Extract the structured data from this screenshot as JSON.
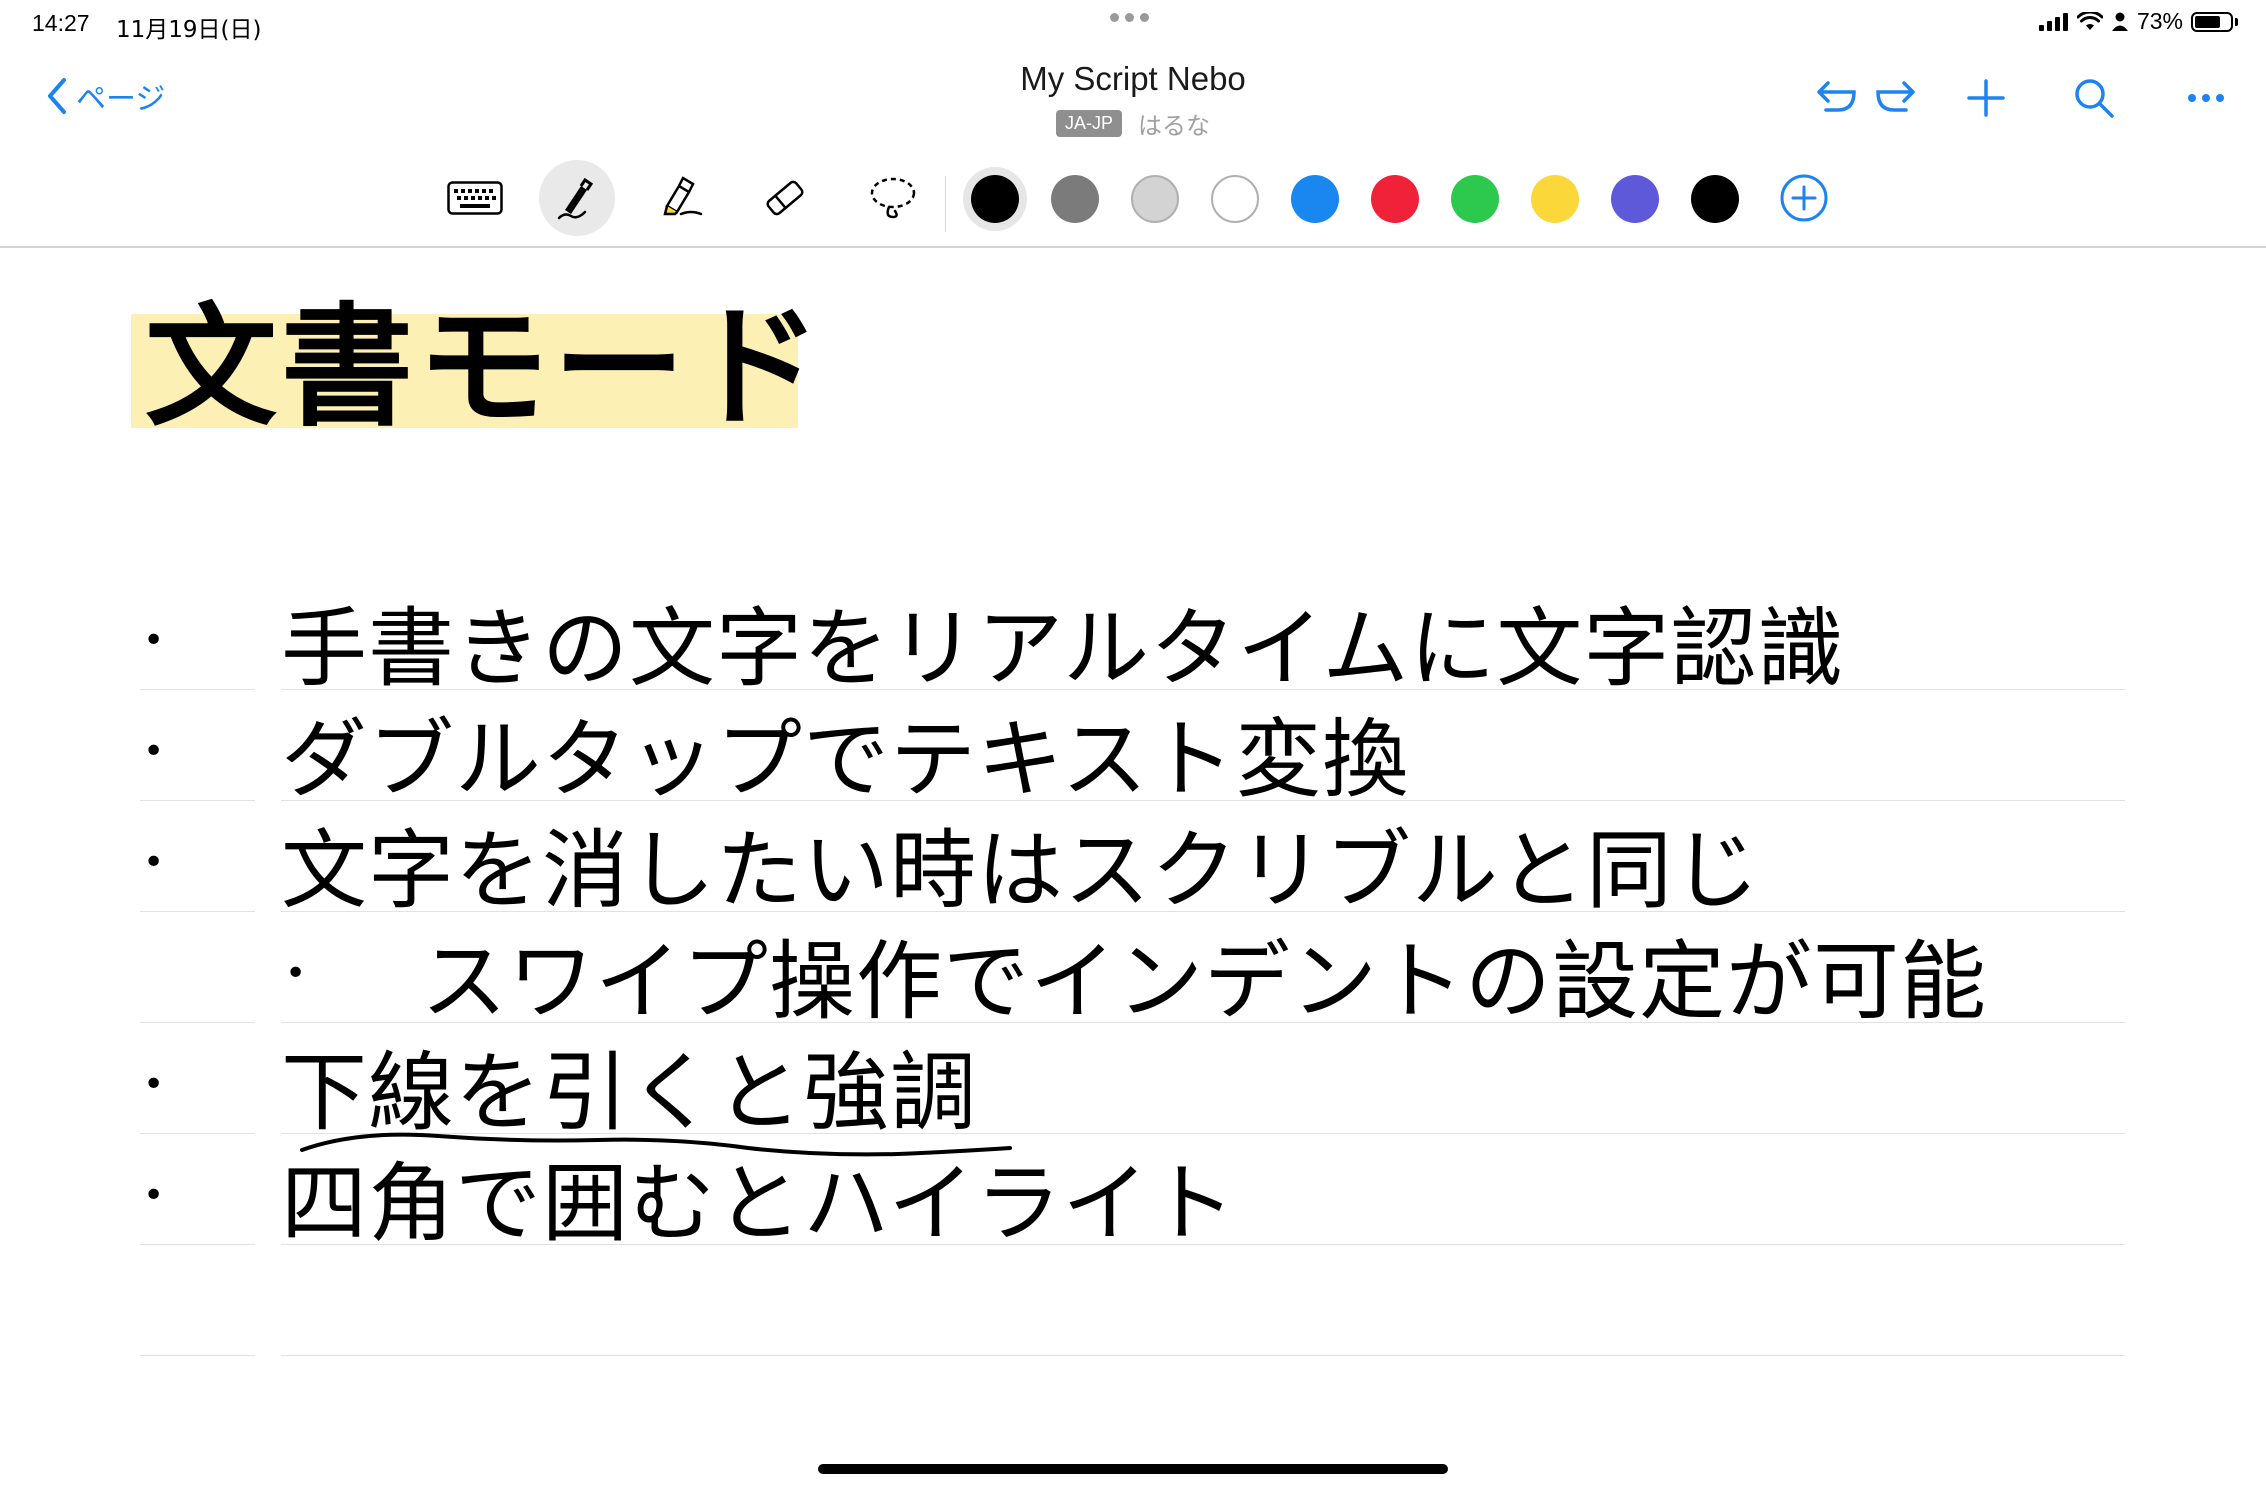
{
  "status_bar": {
    "time": "14:27",
    "date": "11月19日(日)",
    "battery": "73%",
    "battery_level": 0.73
  },
  "nav": {
    "back_label": "ページ",
    "title": "My Script Nebo",
    "language_badge": "JA-JP",
    "handwriting_name": "はるな",
    "accent_color": "#1e83f2"
  },
  "toolbar": {
    "tools": [
      "keyboard-icon",
      "pen-icon",
      "highlighter-icon",
      "eraser-icon",
      "lasso-icon"
    ],
    "selected_tool": "pen-icon",
    "colors": [
      "#000000",
      "#7b7b7b",
      "#d3d3d3",
      "#ffffff",
      "#1a86f0",
      "#f0223a",
      "#2dc94e",
      "#fbd73a",
      "#5e59d8",
      "#000000"
    ],
    "selected_color": "#000000"
  },
  "document": {
    "heading": "文書モード",
    "heading_highlight_color": "#fdf0b5",
    "items": [
      {
        "level": 1,
        "text": "手書きの文字をリアルタイムに文字認識"
      },
      {
        "level": 1,
        "text": "ダブルタップでテキスト変換"
      },
      {
        "level": 1,
        "text": "文字を消したい時はスクリブルと同じ"
      },
      {
        "level": 2,
        "text": "スワイプ操作でインデントの設定が可能"
      },
      {
        "level": 1,
        "text": "下線を引くと強調"
      },
      {
        "level": 1,
        "text": "四角で囲むとハイライト"
      }
    ]
  }
}
